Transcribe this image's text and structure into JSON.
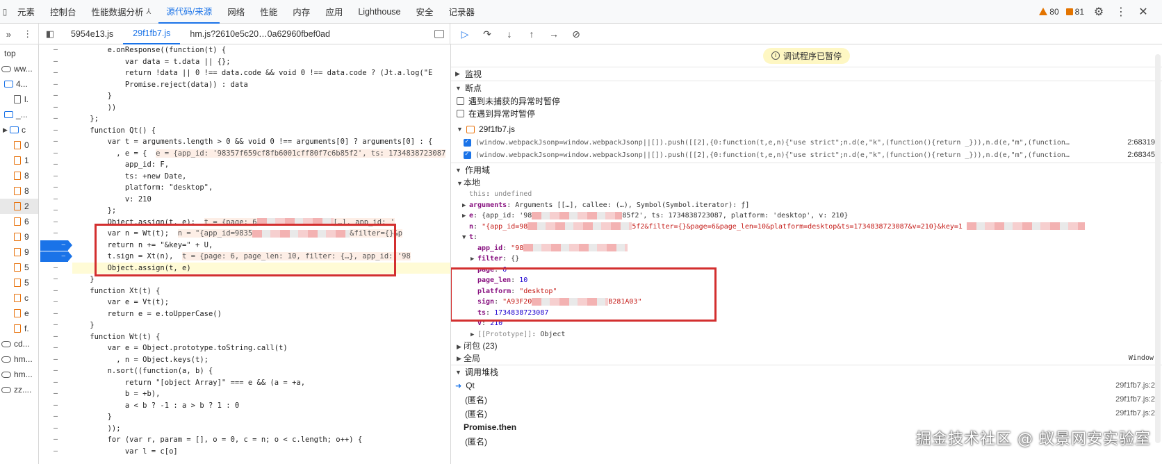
{
  "devtools": {
    "tabs": [
      "元素",
      "控制台",
      "性能数据分析",
      "源代码/来源",
      "网络",
      "性能",
      "内存",
      "应用",
      "Lighthouse",
      "安全",
      "记录器"
    ],
    "active_tab": "源代码/来源",
    "pin_glyph": "⅄",
    "warnings": "80",
    "errors": "81"
  },
  "file_tabs": [
    "5954e13.js",
    "29f1fb7.js",
    "hm.js?2610e5c20…0a62960fbef0ad"
  ],
  "active_file": "29f1fb7.js",
  "navigator": [
    {
      "indent": 6,
      "icon": "none",
      "label": "top"
    },
    {
      "indent": 2,
      "icon": "cloud",
      "label": "ww..."
    },
    {
      "indent": 6,
      "icon": "folder",
      "label": "4..."
    },
    {
      "indent": 20,
      "icon": "file-gray",
      "label": "l."
    },
    {
      "indent": 6,
      "icon": "folder",
      "label": "_..."
    },
    {
      "indent": 4,
      "icon": "folder-tri",
      "label": "c"
    },
    {
      "indent": 20,
      "icon": "file",
      "label": "0"
    },
    {
      "indent": 20,
      "icon": "file",
      "label": "1"
    },
    {
      "indent": 20,
      "icon": "file",
      "label": "8"
    },
    {
      "indent": 20,
      "icon": "file",
      "label": "8"
    },
    {
      "indent": 20,
      "icon": "file",
      "label": "2"
    },
    {
      "indent": 20,
      "icon": "file",
      "label": "6"
    },
    {
      "indent": 20,
      "icon": "file",
      "label": "9"
    },
    {
      "indent": 20,
      "icon": "file",
      "label": "9"
    },
    {
      "indent": 20,
      "icon": "file",
      "label": "5"
    },
    {
      "indent": 20,
      "icon": "file",
      "label": "5"
    },
    {
      "indent": 20,
      "icon": "file",
      "label": "c"
    },
    {
      "indent": 20,
      "icon": "file",
      "label": "e"
    },
    {
      "indent": 20,
      "icon": "file",
      "label": "f."
    },
    {
      "indent": 2,
      "icon": "cloud",
      "label": "cd..."
    },
    {
      "indent": 2,
      "icon": "cloud",
      "label": "hm..."
    },
    {
      "indent": 2,
      "icon": "cloud",
      "label": "hm..."
    },
    {
      "indent": 2,
      "icon": "cloud",
      "label": "zz...."
    }
  ],
  "code_lines": [
    "        e.onResponse((function(t) {",
    "            var data = t.data || {};",
    "            return !data || 0 !== data.code && void 0 !== data.code ? (Jt.a.log(\"E",
    "            Promise.reject(data)) : data",
    "        }",
    "        ))",
    "    };",
    "    function Qt() {",
    "        var t = arguments.length > 0 && void 0 !== arguments[0] ? arguments[0] : {",
    "          , e = {",
    "            app_id: F,",
    "            ts: +new Date,",
    "            platform: \"desktop\",",
    "            v: 210",
    "        };",
    "        Object.assign(t, e);",
    "        var n = Wt(t);",
    "        return n += \"&key=\" + U,",
    "        t.sign = Xt(n),",
    "        Object.assign(t, e)",
    "    }",
    "    function Xt(t) {",
    "        var e = Vt(t);",
    "        return e = e.toUpperCase()",
    "    }",
    "    function Wt(t) {",
    "        var e = Object.prototype.toString.call(t)",
    "          , n = Object.keys(t);",
    "        n.sort((function(a, b) {",
    "            return \"[object Array]\" === e && (a = +a,",
    "            b = +b),",
    "            a < b ? -1 : a > b ? 1 : 0",
    "        }",
    "        ));",
    "        for (var r, param = [], o = 0, c = n; o < c.length; o++) {",
    "            var l = c[o]"
  ],
  "inline_values": {
    "e_line": "e = {app_id: '98357f659cf8fb6001cff80f7c6b85f2', ts: 1734838723087",
    "assign_line": "t = {page: 6",
    "assign_line_tail": "[…], app_id: '",
    "wt_line": "n = \"{app_id=9835",
    "wt_line_tail": "&filter={}&p",
    "sign_line": "t = {page: 6, page_len: 10, filter: {…}, app_id: '98"
  },
  "debugger": {
    "paused_text": "调试程序已暂停",
    "sections": {
      "watch": "监视",
      "breakpoints": "断点",
      "scope": "作用域",
      "callstack": "调用堆栈"
    },
    "pause_options": [
      "遇到未捕获的异常时暂停",
      "在遇到异常时暂停"
    ],
    "bp_file": "29f1fb7.js",
    "bp_entries": [
      {
        "text": "(window.webpackJsonp=window.webpackJsonp||[]).push([[2],{0:function(t,e,n){\"use strict\";n.d(e,\"k\",(function(){return _})),n.d(e,\"m\",(function(){retu…",
        "loc": "2:68319"
      },
      {
        "text": "(window.webpackJsonp=window.webpackJsonp||[]).push([[2],{0:function(t,e,n){\"use strict\";n.d(e,\"k\",(function(){return _})),n.d(e,\"m\",(function(){retu…",
        "loc": "2:68345"
      }
    ],
    "scope_local_label": "本地",
    "scope_lines": {
      "this": "undefined",
      "arguments": "Arguments [[…], callee: (…), Symbol(Symbol.iterator): ƒ]",
      "e_head": "{app_id: '98",
      "e_tail": "85f2', ts: 1734838723087, platform: 'desktop', v: 210}",
      "n_head": "\"{app_id=98",
      "n_tail": "5f2&filter={}&page=6&page_len=10&platform=desktop&ts=1734838723087&v=210}&key=1",
      "app_id": "\"98",
      "filter": "{}",
      "page": "6",
      "page_len": "10",
      "platform": "\"desktop\"",
      "sign_head": "\"A93F20",
      "sign_tail": "B281A03\"",
      "ts": "1734838723087",
      "v": "210",
      "prototype": "Object"
    },
    "closure": "闭包 (23)",
    "global": "全局",
    "global_value": "Window",
    "stack": [
      {
        "name": "Qt",
        "loc": "29f1fb7.js:2",
        "current": true
      },
      {
        "name": "(匿名)",
        "loc": "29f1fb7.js:2",
        "current": false
      },
      {
        "name": "(匿名)",
        "loc": "29f1fb7.js:2",
        "current": false
      }
    ],
    "promise_then": "Promise.then",
    "trailing_anon": "(匿名)"
  },
  "watermark": "掘金技术社区 @ 蚁景网安实验室",
  "colors": {
    "accent": "#1a73e8",
    "highlight_box": "#d32f2f",
    "paused_line": "#fffbd6"
  }
}
